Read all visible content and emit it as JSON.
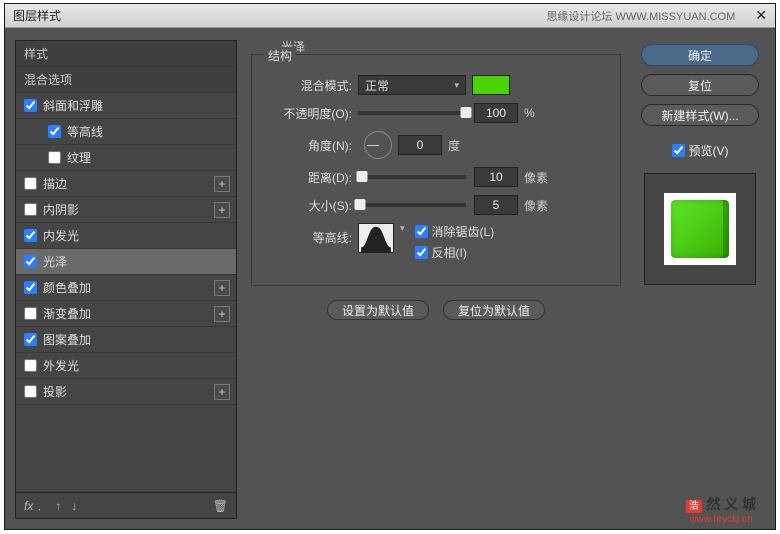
{
  "titlebar": {
    "title": "图层样式",
    "forum": "思缘设计论坛  WWW.MISSYUAN.COM"
  },
  "sidebar": {
    "header_styles": "样式",
    "header_blend": "混合选项",
    "items": [
      {
        "label": "斜面和浮雕",
        "checked": true
      },
      {
        "label": "等高线",
        "checked": true,
        "indent": true
      },
      {
        "label": "纹理",
        "checked": false,
        "indent": true
      },
      {
        "label": "描边",
        "checked": false,
        "plus": true
      },
      {
        "label": "内阴影",
        "checked": false,
        "plus": true
      },
      {
        "label": "内发光",
        "checked": true
      },
      {
        "label": "光泽",
        "checked": true,
        "selected": true
      },
      {
        "label": "颜色叠加",
        "checked": true,
        "plus": true
      },
      {
        "label": "渐变叠加",
        "checked": false,
        "plus": true
      },
      {
        "label": "图案叠加",
        "checked": true
      },
      {
        "label": "外发光",
        "checked": false
      },
      {
        "label": "投影",
        "checked": false,
        "plus": true
      }
    ],
    "footer_fx": "fx"
  },
  "center": {
    "panel_title": "光泽",
    "legend": "结构",
    "blend_label": "混合模式:",
    "blend_value": "正常",
    "opacity_label": "不透明度(O):",
    "opacity_value": "100",
    "opacity_unit": "%",
    "angle_label": "角度(N):",
    "angle_value": "0",
    "angle_unit": "度",
    "distance_label": "距离(D):",
    "distance_value": "10",
    "distance_unit": "像素",
    "size_label": "大小(S):",
    "size_value": "5",
    "size_unit": "像素",
    "contour_label": "等高线:",
    "antialias_label": "消除锯齿(L)",
    "antialias_checked": true,
    "invert_label": "反相(I)",
    "invert_checked": true,
    "btn_default": "设置为默认值",
    "btn_reset": "复位为默认值"
  },
  "right": {
    "ok": "确定",
    "reset": "复位",
    "new_style": "新建样式(W)...",
    "preview_label": "预览(V)",
    "preview_checked": true
  },
  "watermark": {
    "badge": "浩",
    "txt": "然 义 城",
    "url": "www.hryckj.cn"
  },
  "colors": {
    "swatch": "#4cd400"
  }
}
